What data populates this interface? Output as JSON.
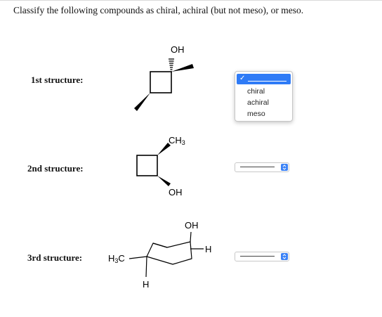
{
  "question": "Classify the following compounds as chiral, achiral (but not meso), or meso.",
  "structures": [
    {
      "label": "1st structure:",
      "groups": {
        "top": "OH"
      }
    },
    {
      "label": "2nd structure:",
      "groups": {
        "top": "CH3",
        "bottom": "OH"
      }
    },
    {
      "label": "3rd structure:",
      "groups": {
        "top": "OH",
        "right": "H",
        "left": "H3C",
        "bottom": "H"
      }
    }
  ],
  "dropdown_open": {
    "selected_value": "",
    "options": [
      "chiral",
      "achiral",
      "meso"
    ]
  },
  "selects": [
    {
      "selected_value": ""
    },
    {
      "selected_value": ""
    }
  ],
  "icons": {
    "checkmark": "checkmark-icon",
    "select_arrows": "up-down-chevron-icon"
  },
  "colors": {
    "accent": "#2f7bf6",
    "select_arrow_bg": "#3b82f6"
  }
}
